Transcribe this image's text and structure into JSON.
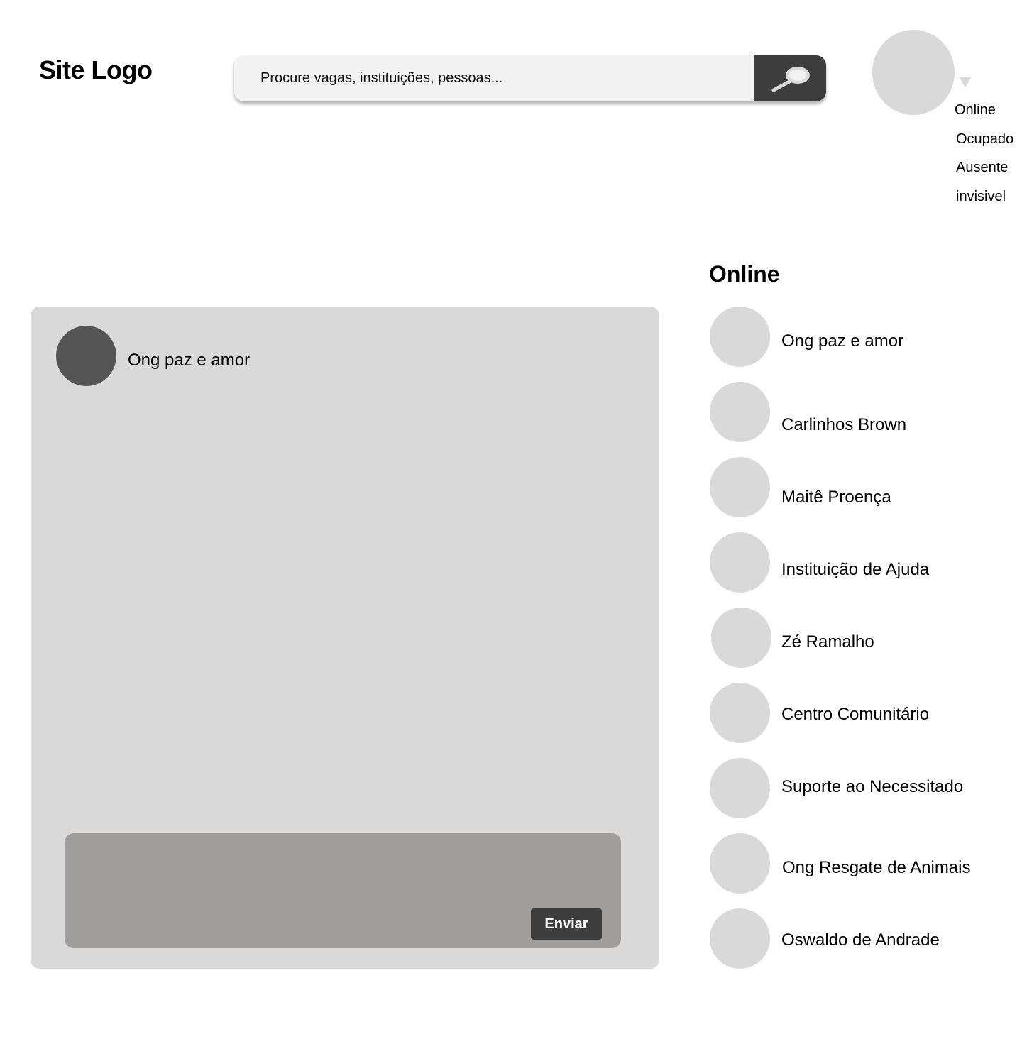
{
  "header": {
    "logo": "Site Logo",
    "search": {
      "placeholder": "Procure vagas, instituições, pessoas..."
    },
    "status_menu": [
      "Online",
      "Ocupado",
      "Ausente",
      "invisivel"
    ]
  },
  "chat": {
    "contact_name": "Ong paz e amor",
    "send_label": "Enviar"
  },
  "online": {
    "title": "Online",
    "contacts": [
      "Ong paz e amor",
      "Carlinhos Brown",
      "Maitê Proença",
      "Instituição de Ajuda",
      "Zé Ramalho",
      "Centro Comunitário",
      "Suporte ao Necessitado",
      "Ong Resgate de Animais",
      "Oswaldo de Andrade"
    ]
  },
  "colors": {
    "panel": "#d9d9d9",
    "composer": "#a09e9d",
    "button": "#3d3d3d",
    "chat_avatar": "#555555"
  }
}
